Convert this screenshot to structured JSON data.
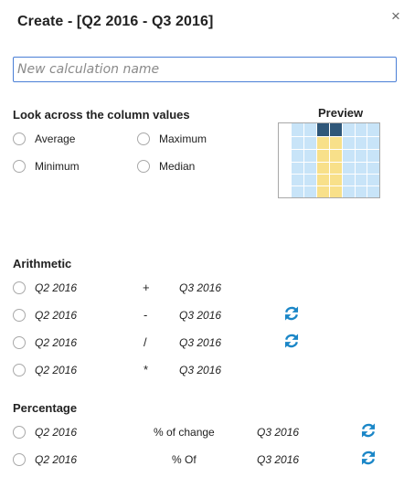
{
  "dialog": {
    "title": "Create - [Q2 2016 - Q3 2016]",
    "close_glyph": "×",
    "name_placeholder": "New calculation name",
    "name_value": ""
  },
  "look_across": {
    "heading": "Look across the column values",
    "options": [
      "Average",
      "Maximum",
      "Minimum",
      "Median"
    ]
  },
  "preview": {
    "label": "Preview",
    "colors": {
      "light": "#c8e4f8",
      "highlight": "#f8e08a",
      "header": "#2f5779"
    }
  },
  "arithmetic": {
    "heading": "Arithmetic",
    "rows": [
      {
        "left": "Q2 2016",
        "op": "+",
        "right": "Q3 2016",
        "refresh": false
      },
      {
        "left": "Q2 2016",
        "op": "-",
        "right": "Q3 2016",
        "refresh": true
      },
      {
        "left": "Q2 2016",
        "op": "/",
        "right": "Q3 2016",
        "refresh": true
      },
      {
        "left": "Q2 2016",
        "op": "*",
        "right": "Q3 2016",
        "refresh": false
      }
    ]
  },
  "percentage": {
    "heading": "Percentage",
    "rows": [
      {
        "left": "Q2 2016",
        "op": "% of change",
        "right": "Q3 2016",
        "refresh": true
      },
      {
        "left": "Q2 2016",
        "op": "% Of",
        "right": "Q3 2016",
        "refresh": true
      }
    ]
  },
  "icons": {
    "close": "close-icon",
    "refresh": "refresh-icon"
  },
  "accent_color": "#1a86c7"
}
